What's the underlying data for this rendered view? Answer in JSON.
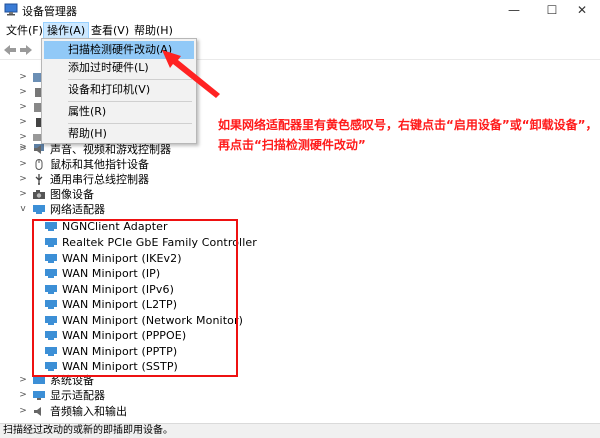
{
  "window": {
    "title": "设备管理器",
    "min_glyph": "—",
    "max_glyph": "☐",
    "close_glyph": "✕"
  },
  "menubar": {
    "items": [
      "文件(F)",
      "操作(A)",
      "查看(V)",
      "帮助(H)"
    ]
  },
  "dropdown": {
    "items": [
      "扫描检测硬件改动(A)",
      "添加过时硬件(L)",
      "设备和打印机(V)",
      "属性(R)",
      "帮助(H)"
    ]
  },
  "tree": {
    "top_rows": [
      {
        "label": "",
        "expanded": false
      },
      {
        "label": "",
        "expanded": false
      },
      {
        "label": "",
        "expanded": false
      },
      {
        "label": "",
        "expanded": false
      },
      {
        "label": "",
        "expanded": false
      },
      {
        "label": "",
        "expanded": false
      },
      {
        "label": "",
        "expanded": false
      }
    ],
    "categories_before": [
      {
        "label": "声音、视频和游戏控制器"
      },
      {
        "label": "鼠标和其他指针设备"
      },
      {
        "label": "通用串行总线控制器"
      },
      {
        "label": "图像设备"
      }
    ],
    "network_category": "网络适配器",
    "network_adapters": [
      "NGNClient Adapter",
      "Realtek PCIe GbE Family Controller",
      "WAN Miniport (IKEv2)",
      "WAN Miniport (IP)",
      "WAN Miniport (IPv6)",
      "WAN Miniport (L2TP)",
      "WAN Miniport (Network Monitor)",
      "WAN Miniport (PPPOE)",
      "WAN Miniport (PPTP)",
      "WAN Miniport (SSTP)"
    ],
    "categories_after": [
      {
        "label": "系统设备"
      },
      {
        "label": "显示适配器"
      },
      {
        "label": "音频输入和输出"
      }
    ]
  },
  "annotation": {
    "text": "如果网络适配器里有黄色感叹号，右键点击“启用设备”或“卸载设备”，再点击“扫描检测硬件改动”"
  },
  "statusbar": {
    "text": "扫描经过改动的或新的即插即用设备。"
  },
  "colors": {
    "annotation_red": "#ff1a1a",
    "menu_highlight": "#91c9f7"
  }
}
